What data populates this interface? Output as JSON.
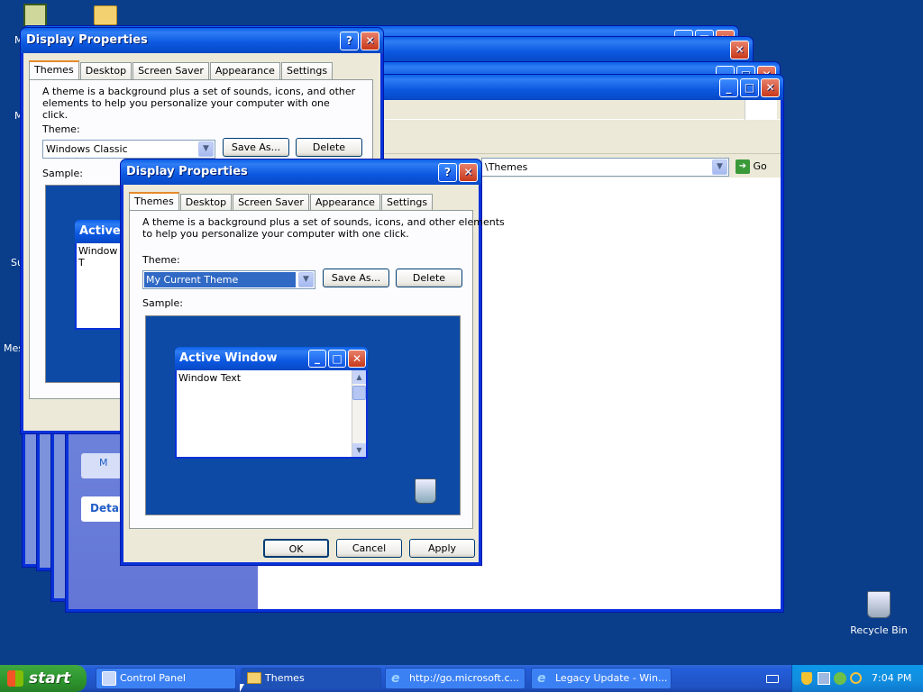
{
  "desktop": {
    "recycle_bin_label": "Recycle Bin",
    "left_partial_labels": [
      "M",
      "M",
      "Su",
      "Mes"
    ]
  },
  "back_window": {
    "title": "Display Properties",
    "tabs": [
      "Themes",
      "Desktop",
      "Screen Saver",
      "Appearance",
      "Settings"
    ],
    "description": "A theme is a background plus a set of sounds, icons, and other elements to help you personalize your computer with one click.",
    "theme_label": "Theme:",
    "theme_value": "Windows Classic",
    "save_as": "Save As...",
    "delete": "Delete",
    "sample_label": "Sample:",
    "sample_window_title": "Active W",
    "sample_window_text": "Window T"
  },
  "explorer": {
    "address_text": "\\Themes",
    "go_label": "Go",
    "details_label": "Detail",
    "other_label": "M"
  },
  "front_window": {
    "title": "Display Properties",
    "tabs": [
      "Themes",
      "Desktop",
      "Screen Saver",
      "Appearance",
      "Settings"
    ],
    "description_line1": "A theme is a background plus a set of sounds, icons, and other elements",
    "description_line2": "to help you personalize your computer with one click.",
    "theme_label": "Theme:",
    "theme_value": "My Current Theme",
    "save_as": "Save As...",
    "delete": "Delete",
    "sample_label": "Sample:",
    "sample_window_title": "Active Window",
    "sample_window_text": "Window Text",
    "ok": "OK",
    "cancel": "Cancel",
    "apply": "Apply"
  },
  "taskbar": {
    "start_label": "start",
    "tasks": [
      {
        "label": "Control Panel"
      },
      {
        "label": "Themes"
      },
      {
        "label": "http://go.microsoft.c..."
      },
      {
        "label": "Legacy Update - Win..."
      }
    ],
    "clock": "7:04 PM"
  },
  "colors": {
    "desktop_bg": "#0b3e8a",
    "title_blue": "#0a5fe8",
    "selection": "#316ac5",
    "start_green": "#3fa83f"
  }
}
